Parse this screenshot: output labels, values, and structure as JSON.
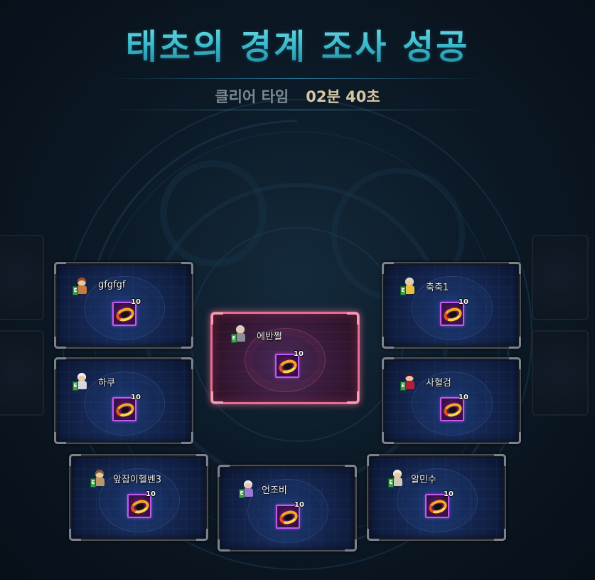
{
  "title": "태초의 경계 조사 성공",
  "clear_time": {
    "label": "클리어 타임",
    "value": "02분 40초"
  },
  "party": [
    {
      "name": "gfgfgf",
      "item_level": "10"
    },
    {
      "name": "축축1",
      "item_level": "10"
    },
    {
      "name": "에반쩔",
      "item_level": "10",
      "highlighted": true
    },
    {
      "name": "하쿠",
      "item_level": "10"
    },
    {
      "name": "사혈검",
      "item_level": "10"
    },
    {
      "name": "앞잡이헬벤3",
      "item_level": "10"
    },
    {
      "name": "언조비",
      "item_level": "10"
    },
    {
      "name": "알민수",
      "item_level": "10"
    }
  ],
  "colors": {
    "title": "#5fd0de",
    "highlight_border": "#e2708e",
    "item_border": "#c15cf0",
    "clear_time_value": "#d6c7a1"
  }
}
